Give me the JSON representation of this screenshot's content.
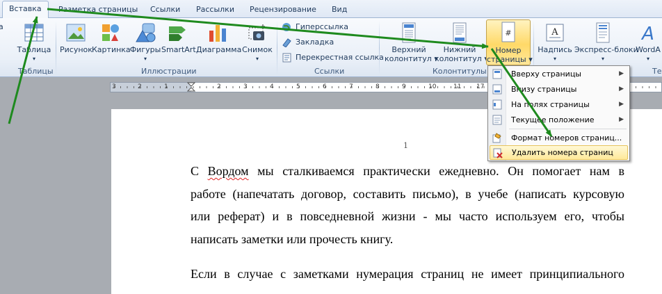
{
  "tabs": [
    "Вставка",
    "Разметка страницы",
    "Ссылки",
    "Рассылки",
    "Рецензирование",
    "Вид"
  ],
  "ribbon": {
    "left_fragment": "а",
    "table": {
      "label": "Таблица",
      "group": "Таблицы"
    },
    "illustrations": {
      "group": "Иллюстрации",
      "buttons": [
        "Рисунок",
        "Картинка",
        "Фигуры",
        "SmartArt",
        "Диаграмма",
        "Снимок"
      ]
    },
    "links": {
      "group": "Ссылки",
      "buttons": [
        "Гиперссылка",
        "Закладка",
        "Перекрестная ссылка"
      ]
    },
    "header_footer": {
      "group": "Колонтитулы",
      "header": [
        "Верхний",
        "колонтитул"
      ],
      "footer": [
        "Нижний",
        "колонтитул"
      ],
      "page_number": [
        "Номер",
        "страницы"
      ]
    },
    "text": {
      "group": "Те",
      "buttons": [
        "Надпись",
        "Экспресс-блоки",
        "WordA"
      ]
    }
  },
  "ruler": {
    "numbers": [
      "3",
      "1",
      "2",
      "1",
      "1",
      "1",
      "2",
      "3",
      "4",
      "5",
      "6",
      "7",
      "8",
      "9",
      "10",
      "11",
      "17"
    ]
  },
  "page_number_menu": {
    "items": [
      {
        "label": "Вверху страницы",
        "submenu": true
      },
      {
        "label": "Внизу страницы",
        "submenu": true
      },
      {
        "label": "На полях страницы",
        "submenu": true
      },
      {
        "label": "Текущее положение",
        "submenu": true
      },
      {
        "label": "Формат номеров страниц...",
        "submenu": false
      },
      {
        "label": "Удалить номера страниц",
        "submenu": false,
        "highlighted": true
      }
    ]
  },
  "document": {
    "page_number": "1",
    "paragraph1": [
      [
        "С ",
        "Вордом",
        " мы сталкиваемся практически ежедневно. Он помогает нам в"
      ],
      "работе (напечатать договор, составить письмо), в учебе (написать курсовую",
      "или реферат) и в повседневной жизни - мы часто используем его, чтобы",
      "написать заметки или прочесть книгу."
    ],
    "paragraph2": [
      "Если в случае с заметками нумерация страниц не имеет принципиального"
    ]
  },
  "colors": {
    "arrow": "#1e8a1e",
    "highlight": "#ffe38a",
    "spell_error": "#e02020"
  }
}
